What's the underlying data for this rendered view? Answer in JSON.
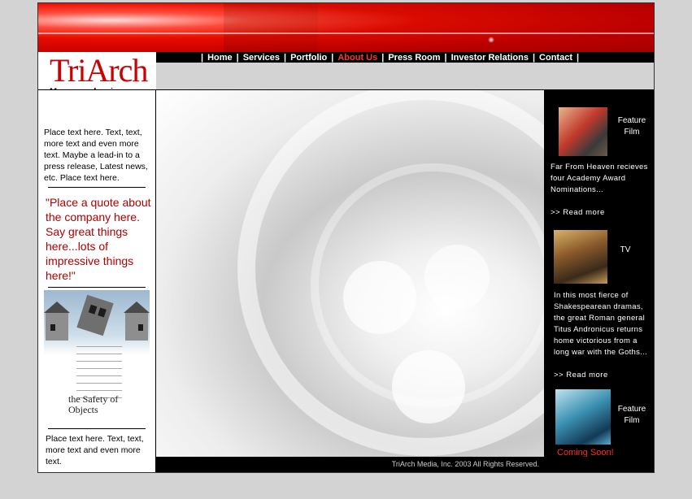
{
  "brand": {
    "name": "TriArch",
    "subtitle": "M·e·d·i·a"
  },
  "nav": {
    "items": [
      {
        "label": "Home",
        "active": false
      },
      {
        "label": "Services",
        "active": false
      },
      {
        "label": "Portfolio",
        "active": false
      },
      {
        "label": "About Us",
        "active": true
      },
      {
        "label": "Press Room",
        "active": false
      },
      {
        "label": "Investor Relations",
        "active": false
      },
      {
        "label": "Contact",
        "active": false
      }
    ],
    "separator": "|"
  },
  "sidebar": {
    "intro": "Place text here. Text, text, more text and even more text.  Maybe a lead-in to a press release, Latest news, etc.  Place text here.",
    "quote": "\"Place a quote about the company here. Say great things here...lots of impressive things here!\"",
    "poster_title": "the Safety of Objects",
    "outro": "Place text here. Text, text, more text and even more text."
  },
  "features": [
    {
      "label": "Feature Film",
      "body": "Far From Heaven recieves four Academy Award Nominations...",
      "more": ">> Read more"
    },
    {
      "label": "TV",
      "body": "In this most fierce of Shakespearean dramas, the great Roman general Titus Andronicus returns home victorious from a long war with the Goths...",
      "more": ">> Read more"
    },
    {
      "label": "Feature Film",
      "body": "Coming Soon!"
    }
  ],
  "footer": {
    "copyright": "TriArch Media, Inc.  2003   All Rights Reserved."
  },
  "colors": {
    "brand_red": "#cc0000",
    "nav_active": "#ff3333",
    "quote": "#b00000",
    "sidebar_bg": "#000000",
    "page_bg": "#d3d3d3"
  }
}
